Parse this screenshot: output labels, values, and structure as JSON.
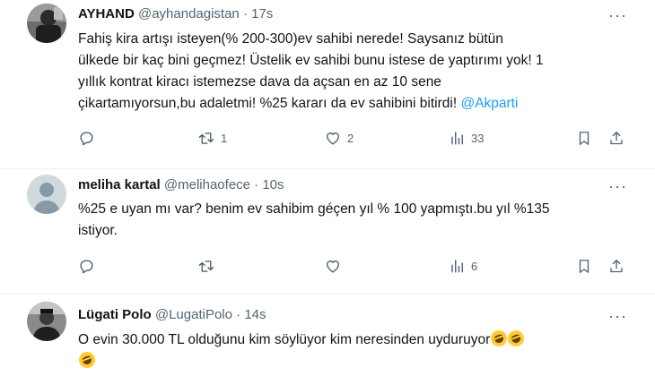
{
  "tweets": [
    {
      "name": "AYHAND",
      "handle": "@ayhandagistan",
      "dot": "·",
      "time": "17s",
      "text_lines": [
        "Fahiş kira artışı isteyen(% 200-300)ev sahibi nerede! Saysanız bütün",
        "ülkede bir kaç bini geçmez! Üstelik ev sahibi bunu istese de yaptırımı yok! 1",
        "yıllık kontrat kiracı istemezse dava da açsan en az 10 sene",
        "çikartamıyorsun,bu adaletmi! %25 kararı da ev sahibini bitirdi! "
      ],
      "mention": "@Akparti",
      "reply_count": "",
      "retweet_count": "1",
      "like_count": "2",
      "view_count": "33"
    },
    {
      "name": "meliha kartal",
      "handle": "@melihaofece",
      "dot": "·",
      "time": "10s",
      "text_lines": [
        "%25 e uyan mı var? benim ev sahibim géçen yıl % 100 yapmıştı.bu yıl %135",
        "istiyor."
      ],
      "reply_count": "",
      "retweet_count": "",
      "like_count": "",
      "view_count": "6"
    },
    {
      "name": "Lügati Polo",
      "handle": "@LugatiPolo",
      "dot": "·",
      "time": "14s",
      "text_lines": [
        "O evin 30.000 TL olduğunu kim söylüyor kim neresinden uyduruyor"
      ],
      "emoji": "rolling-on-the-floor-laughing"
    }
  ],
  "more_label": "···",
  "colors": {
    "text": "#0f1419",
    "secondary": "#536471",
    "link": "#1d9bf0",
    "divider": "#eff3f4"
  },
  "icons": [
    "reply-icon",
    "retweet-icon",
    "like-icon",
    "views-icon",
    "bookmark-icon",
    "share-icon",
    "more-icon"
  ]
}
